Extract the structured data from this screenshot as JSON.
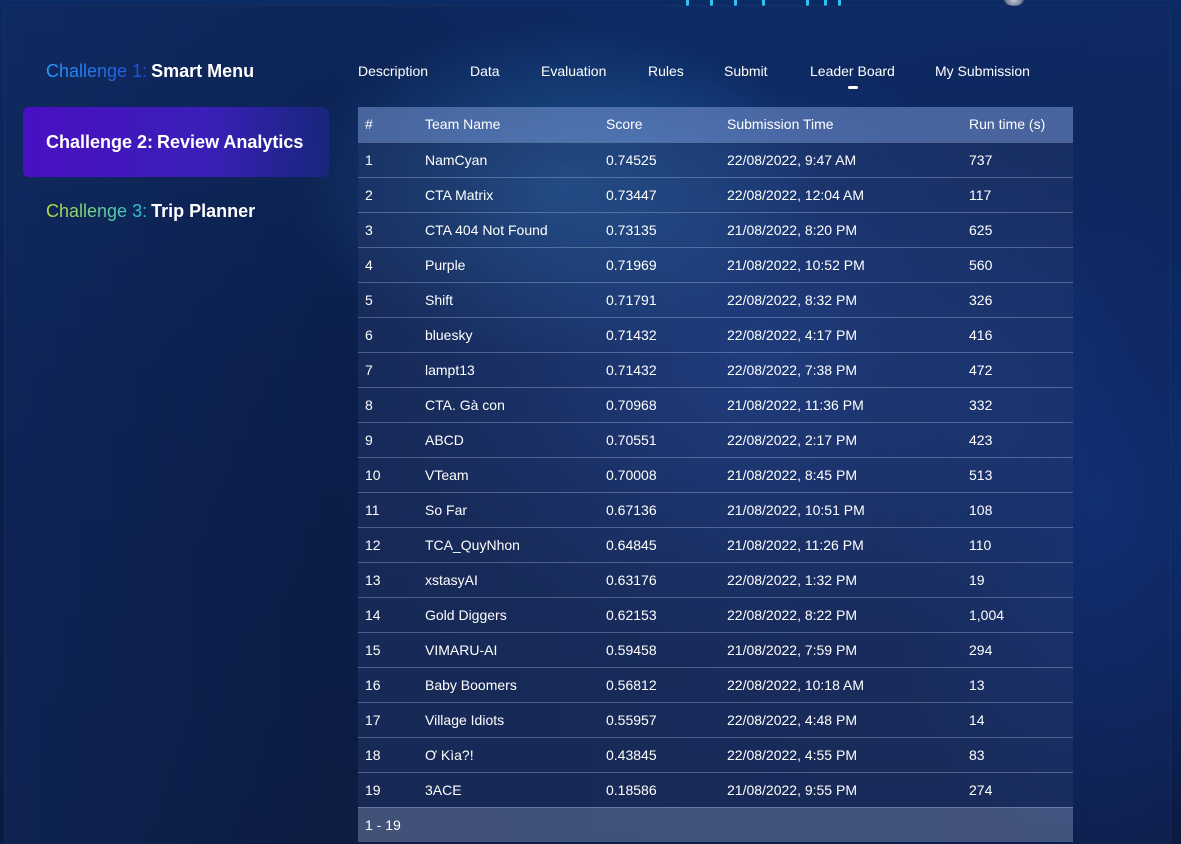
{
  "sidebar": {
    "challenges": [
      {
        "prefix": "Challenge 1:",
        "name": "Smart Menu"
      },
      {
        "prefix": "Challenge 2:",
        "name": "Review Analytics"
      },
      {
        "prefix": "Challenge 3:",
        "name": "Trip Planner"
      }
    ]
  },
  "tabs": [
    "Description",
    "Data",
    "Evaluation",
    "Rules",
    "Submit",
    "Leader Board",
    "My Submission"
  ],
  "active_tab": "Leader Board",
  "leaderboard": {
    "headers": [
      "#",
      "Team Name",
      "Score",
      "Submission Time",
      "Run time (s)"
    ],
    "rows": [
      [
        "1",
        "NamCyan",
        "0.74525",
        "22/08/2022, 9:47 AM",
        "737"
      ],
      [
        "2",
        "CTA Matrix",
        "0.73447",
        "22/08/2022, 12:04 AM",
        "117"
      ],
      [
        "3",
        "CTA 404 Not Found",
        "0.73135",
        "21/08/2022, 8:20 PM",
        "625"
      ],
      [
        "4",
        "Purple",
        "0.71969",
        "21/08/2022, 10:52 PM",
        "560"
      ],
      [
        "5",
        "Shift",
        "0.71791",
        "22/08/2022, 8:32 PM",
        "326"
      ],
      [
        "6",
        "bluesky",
        "0.71432",
        "22/08/2022, 4:17 PM",
        "416"
      ],
      [
        "7",
        "lampt13",
        "0.71432",
        "22/08/2022, 7:38 PM",
        "472"
      ],
      [
        "8",
        "CTA. Gà con",
        "0.70968",
        "21/08/2022, 11:36 PM",
        "332"
      ],
      [
        "9",
        "ABCD",
        "0.70551",
        "22/08/2022, 2:17 PM",
        "423"
      ],
      [
        "10",
        "VTeam",
        "0.70008",
        "21/08/2022, 8:45 PM",
        "513"
      ],
      [
        "11",
        "So Far",
        "0.67136",
        "21/08/2022, 10:51 PM",
        "108"
      ],
      [
        "12",
        "TCA_QuyNhon",
        "0.64845",
        "21/08/2022, 11:26 PM",
        "110"
      ],
      [
        "13",
        "xstasyAI",
        "0.63176",
        "22/08/2022, 1:32 PM",
        "19"
      ],
      [
        "14",
        "Gold Diggers",
        "0.62153",
        "22/08/2022, 8:22 PM",
        "1,004"
      ],
      [
        "15",
        "VIMARU-AI",
        "0.59458",
        "21/08/2022, 7:59 PM",
        "294"
      ],
      [
        "16",
        "Baby Boomers",
        "0.56812",
        "22/08/2022, 10:18 AM",
        "13"
      ],
      [
        "17",
        "Village Idiots",
        "0.55957",
        "22/08/2022, 4:48 PM",
        "14"
      ],
      [
        "18",
        "Ơ Kìa?!",
        "0.43845",
        "22/08/2022, 4:55 PM",
        "83"
      ],
      [
        "19",
        "3ACE",
        "0.18586",
        "21/08/2022, 9:55 PM",
        "274"
      ]
    ],
    "pagination": "1 - 19"
  },
  "colors": {
    "active_challenge": "#4a0fc2",
    "challenge1_prefix": "#2a9bff",
    "challenge3_prefix": "#b8e040"
  }
}
